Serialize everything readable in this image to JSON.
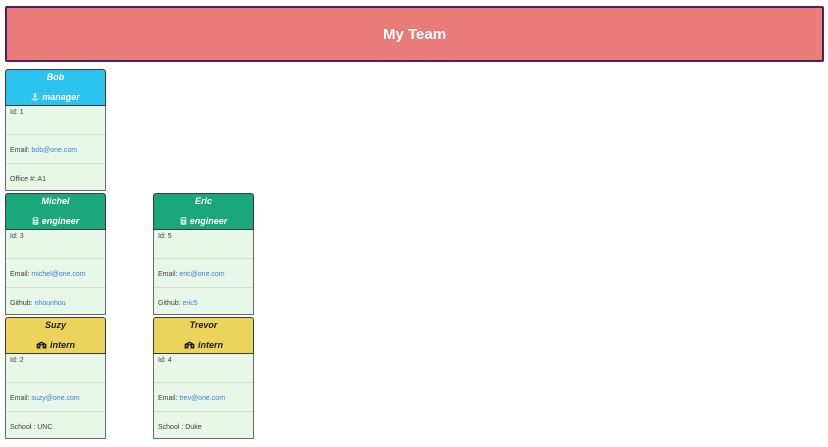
{
  "header": {
    "title": "My Team"
  },
  "team": [
    {
      "name": "Bob",
      "role": "manager",
      "role_icon": "anchor-icon",
      "id_label": "Id:",
      "id": "1",
      "email_label": "Email:",
      "email": "bob@one.com",
      "extra_label": "Office #:",
      "extra": "A1"
    },
    {
      "name": "Michel",
      "role": "engineer",
      "role_icon": "calculator-icon",
      "id_label": "Id:",
      "id": "3",
      "email_label": "Email:",
      "email": "michel@one.com",
      "extra_label": "Github:",
      "extra": "nhounhou"
    },
    {
      "name": "Eric",
      "role": "engineer",
      "role_icon": "calculator-icon",
      "id_label": "Id:",
      "id": "5",
      "email_label": "Email:",
      "email": "eric@one.com",
      "extra_label": "Github:",
      "extra": "eric5"
    },
    {
      "name": "Suzy",
      "role": "intern",
      "role_icon": "school-icon",
      "id_label": "Id:",
      "id": "2",
      "email_label": "Email:",
      "email": "suzy@one.com",
      "extra_label": "School :",
      "extra": "UNC"
    },
    {
      "name": "Trevor",
      "role": "intern",
      "role_icon": "school-icon",
      "id_label": "Id:",
      "id": "4",
      "email_label": "Email:",
      "email": "trev@one.com",
      "extra_label": "School :",
      "extra": "Duke"
    }
  ],
  "colors": {
    "header": "#e97b78",
    "manager": "#2bc4ee",
    "engineer": "#1aa87a",
    "intern": "#ecd35b",
    "card_body": "#e8f8e8",
    "link": "#3b7ddd"
  }
}
